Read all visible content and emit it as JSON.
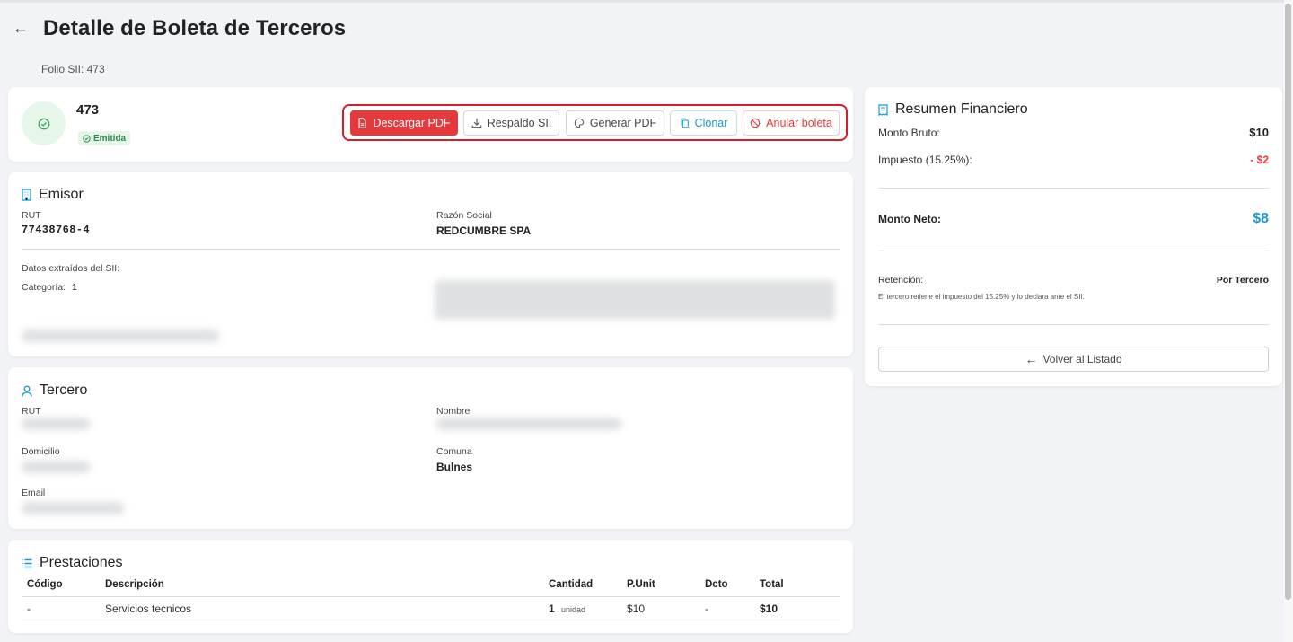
{
  "page": {
    "title": "Detalle de Boleta de Terceros",
    "subtitle": "Folio SII: 473"
  },
  "header": {
    "folio": "473",
    "status": "Emitida",
    "actions": {
      "download_pdf": "Descargar PDF",
      "backup_sii": "Respaldo SII",
      "generate_pdf": "Generar PDF",
      "clone": "Clonar",
      "void": "Anular boleta"
    }
  },
  "emisor": {
    "title": "Emisor",
    "rut_label": "RUT",
    "rut": "77438768-4",
    "razon_label": "Razón Social",
    "razon": "REDCUMBRE SPA",
    "sii_label": "Datos extraídos del SII:",
    "categoria_label": "Categoría:",
    "categoria": "1"
  },
  "tercero": {
    "title": "Tercero",
    "rut_label": "RUT",
    "nombre_label": "Nombre",
    "domicilio_label": "Domicilio",
    "comuna_label": "Comuna",
    "comuna": "Bulnes",
    "email_label": "Email"
  },
  "prestaciones": {
    "title": "Prestaciones",
    "columns": [
      "Código",
      "Descripción",
      "Cantidad",
      "P.Unit",
      "Dcto",
      "Total"
    ],
    "rows": [
      {
        "codigo": "-",
        "descripcion": "Servicios tecnicos",
        "cantidad": "1",
        "unidad": "unidad",
        "punit": "$10",
        "dcto": "-",
        "total": "$10"
      }
    ]
  },
  "resumen": {
    "title": "Resumen Financiero",
    "bruto_label": "Monto Bruto:",
    "bruto": "$10",
    "impuesto_label": "Impuesto (15.25%):",
    "impuesto": "- $2",
    "neto_label": "Monto Neto:",
    "neto": "$8",
    "retencion_label": "Retención:",
    "retencion": "Por Tercero",
    "retencion_note": "El tercero retiene el impuesto del 15.25% y lo declara ante el SII.",
    "back_button": "Volver al Listado"
  },
  "colors": {
    "accent": "#1b9ad0",
    "danger": "#e5393c",
    "success": "#2e8b4a",
    "highlight_frame": "#d91c2a"
  }
}
